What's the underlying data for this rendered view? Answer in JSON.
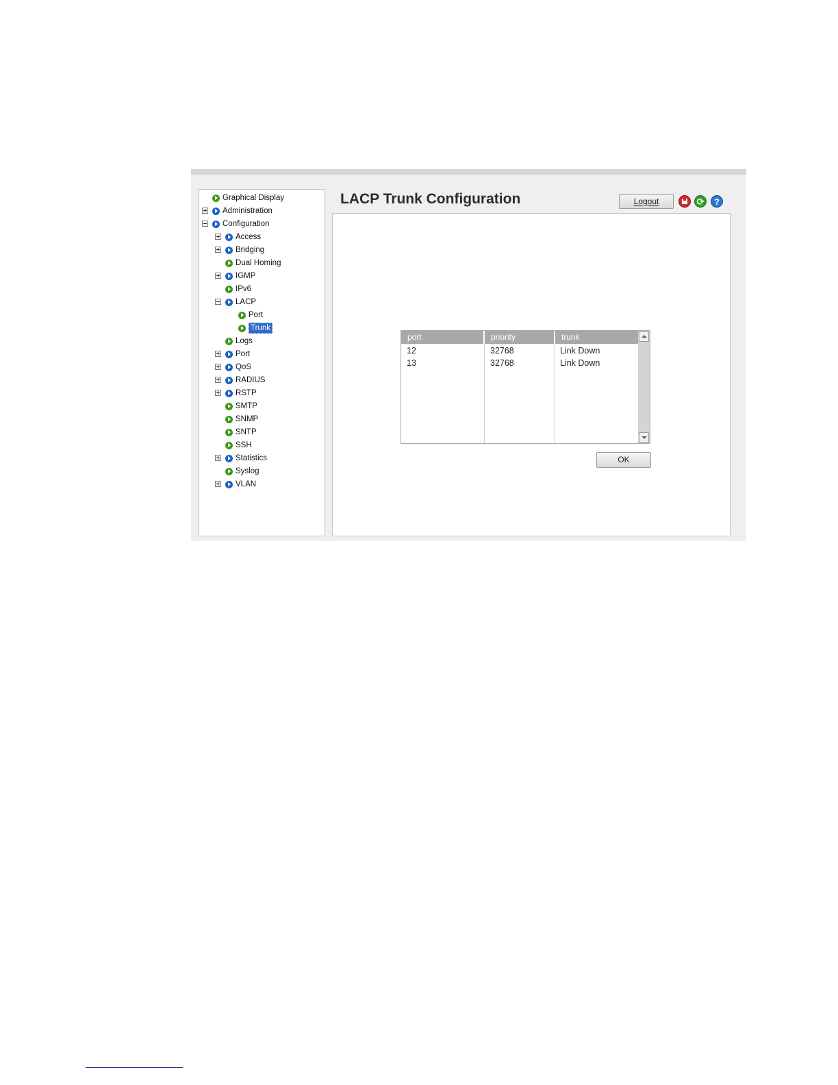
{
  "nav": {
    "items": [
      {
        "label": "Graphical Display",
        "expander": "none",
        "icon": "green",
        "level": 0
      },
      {
        "label": "Administration",
        "expander": "plus",
        "icon": "blue",
        "level": 0
      },
      {
        "label": "Configuration",
        "expander": "minus",
        "icon": "blue",
        "level": 0
      },
      {
        "label": "Access",
        "expander": "plus",
        "icon": "blue",
        "level": 1
      },
      {
        "label": "Bridging",
        "expander": "plus",
        "icon": "blue",
        "level": 1
      },
      {
        "label": "Dual Homing",
        "expander": "none",
        "icon": "green",
        "level": 1
      },
      {
        "label": "IGMP",
        "expander": "plus",
        "icon": "blue",
        "level": 1
      },
      {
        "label": "IPv6",
        "expander": "none",
        "icon": "green",
        "level": 1
      },
      {
        "label": "LACP",
        "expander": "minus",
        "icon": "blue",
        "level": 1
      },
      {
        "label": "Port",
        "expander": "none",
        "icon": "green",
        "level": 2
      },
      {
        "label": "Trunk",
        "expander": "none",
        "icon": "green",
        "level": 2,
        "selected": true
      },
      {
        "label": "Logs",
        "expander": "none",
        "icon": "green",
        "level": 1
      },
      {
        "label": "Port",
        "expander": "plus",
        "icon": "blue",
        "level": 1
      },
      {
        "label": "QoS",
        "expander": "plus",
        "icon": "blue",
        "level": 1
      },
      {
        "label": "RADIUS",
        "expander": "plus",
        "icon": "blue",
        "level": 1
      },
      {
        "label": "RSTP",
        "expander": "plus",
        "icon": "blue",
        "level": 1
      },
      {
        "label": "SMTP",
        "expander": "none",
        "icon": "green",
        "level": 1
      },
      {
        "label": "SNMP",
        "expander": "none",
        "icon": "green",
        "level": 1
      },
      {
        "label": "SNTP",
        "expander": "none",
        "icon": "green",
        "level": 1
      },
      {
        "label": "SSH",
        "expander": "none",
        "icon": "green",
        "level": 1
      },
      {
        "label": "Statistics",
        "expander": "plus",
        "icon": "blue",
        "level": 1
      },
      {
        "label": "Syslog",
        "expander": "none",
        "icon": "green",
        "level": 1
      },
      {
        "label": "VLAN",
        "expander": "plus",
        "icon": "blue",
        "level": 1
      }
    ]
  },
  "header": {
    "title": "LACP Trunk Configuration",
    "logout_label": "Logout",
    "icons": [
      "save-icon",
      "refresh-icon",
      "help-icon"
    ],
    "refresh_glyph": "⟳",
    "help_glyph": "?"
  },
  "table": {
    "columns": [
      "port",
      "priority",
      "trunk"
    ],
    "rows": [
      [
        "12",
        "32768",
        "Link Down"
      ],
      [
        "13",
        "32768",
        "Link Down"
      ]
    ]
  },
  "ok_label": "OK",
  "colors": {
    "selection": "#3169c6",
    "node_green": "#3f9a1c",
    "node_blue": "#1f63c3",
    "header_gray": "#a8a8a8"
  }
}
